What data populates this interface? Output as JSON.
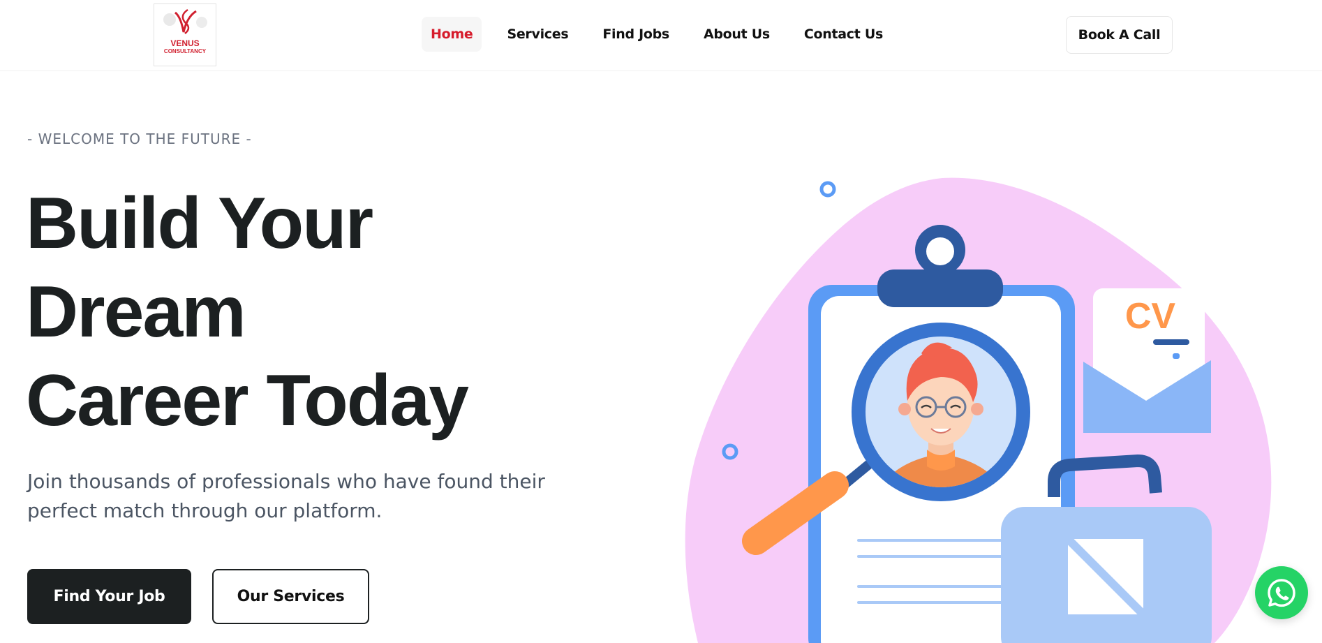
{
  "brand": {
    "logo_line1": "VENUS",
    "logo_line2": "CONSULTANCY",
    "color": "#d01f2e"
  },
  "nav": {
    "items": [
      {
        "label": "Home",
        "active": true
      },
      {
        "label": "Services",
        "active": false
      },
      {
        "label": "Find Jobs",
        "active": false
      },
      {
        "label": "About Us",
        "active": false
      },
      {
        "label": "Contact Us",
        "active": false
      }
    ],
    "cta": "Book A Call"
  },
  "hero": {
    "eyebrow": "- WELCOME TO THE FUTURE -",
    "headline_line1": "Build Your",
    "headline_line2": "Dream",
    "headline_line3": "Career Today",
    "subtext": "Join thousands of professionals who have found their perfect match through our platform.",
    "primary_button": "Find Your Job",
    "secondary_button": "Our Services"
  },
  "illustration": {
    "cv_label": "CV"
  },
  "colors": {
    "accent": "#d61b2b",
    "dark": "#1c2021",
    "blob": "#f7ccf9",
    "blue": "#5b9bf5",
    "navy": "#2e5aa0",
    "orange": "#ff974b",
    "whatsapp": "#25d366"
  },
  "icons": {
    "whatsapp": "whatsapp-icon"
  }
}
